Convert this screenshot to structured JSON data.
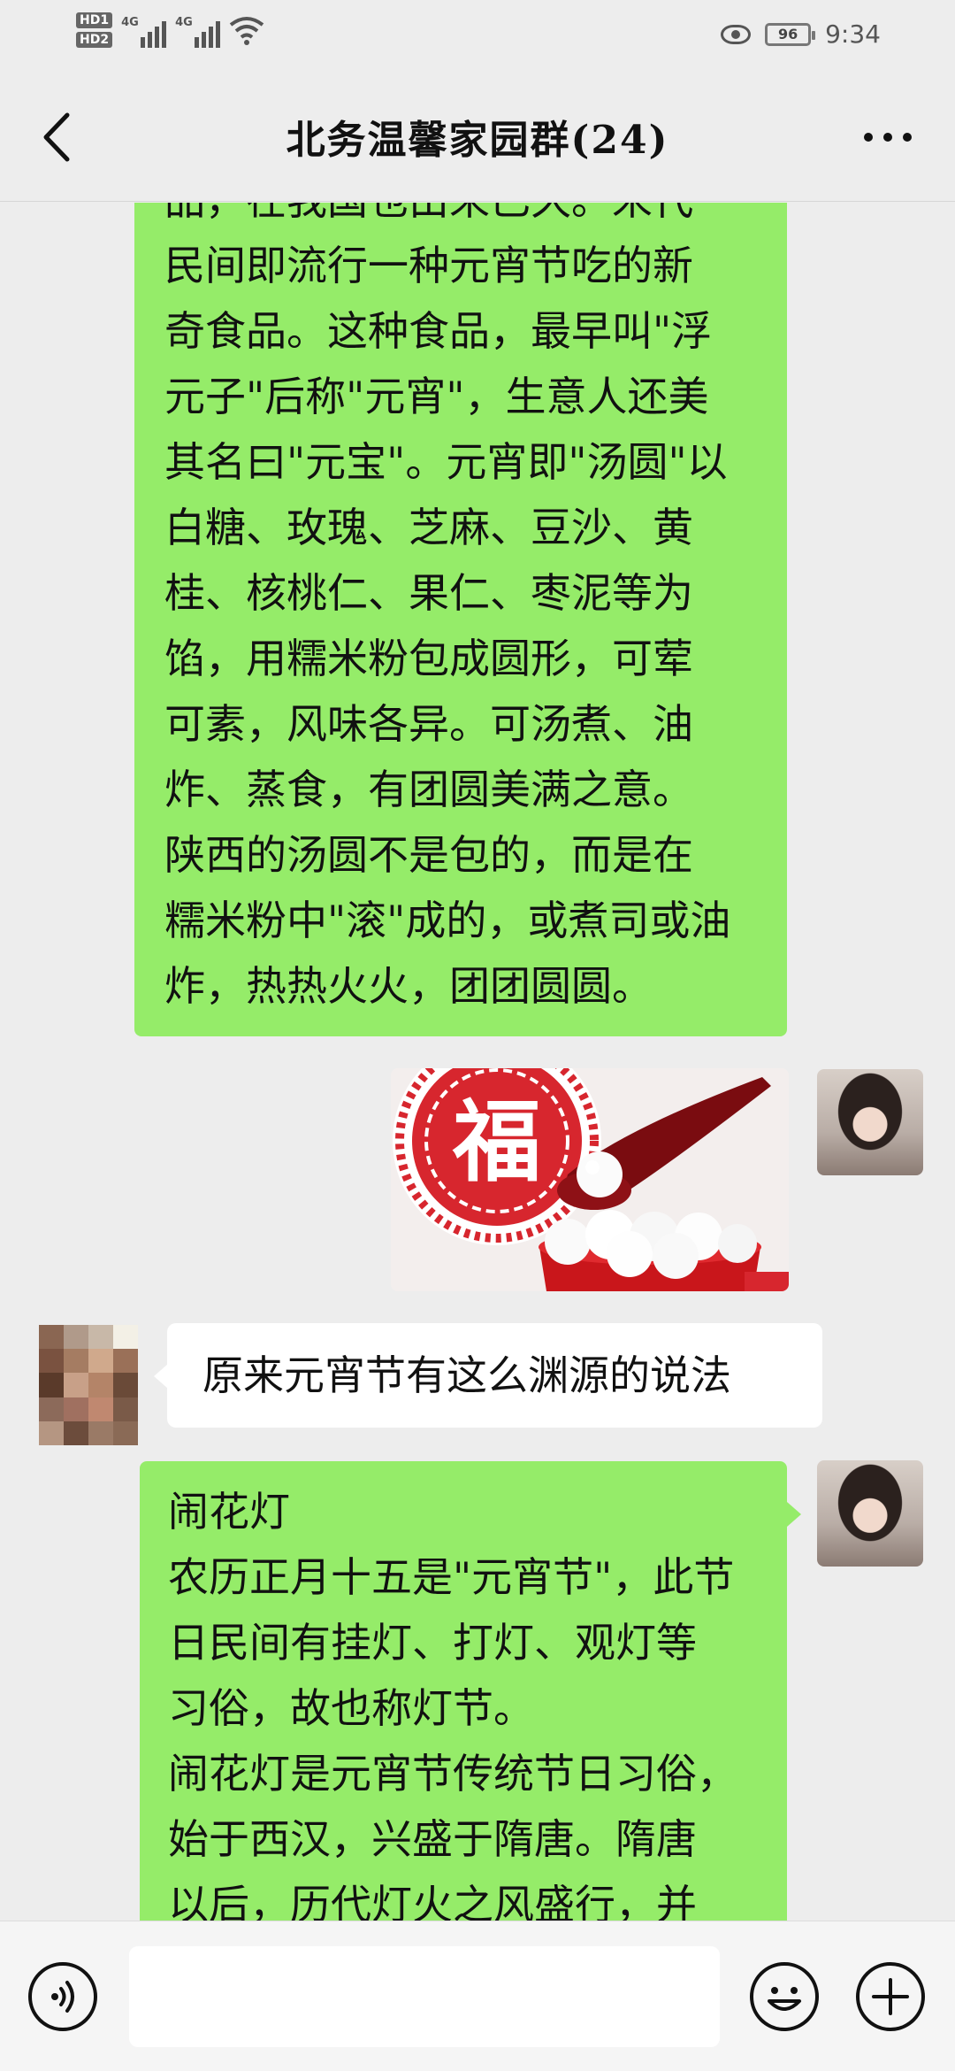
{
  "status_bar": {
    "hd_labels": [
      "HD1",
      "HD2"
    ],
    "network_labels": [
      "4G",
      "4G"
    ],
    "battery": "96",
    "time": "9:34",
    "icons": [
      "hd-icon",
      "signal-icon",
      "wifi-icon",
      "eye-comfort-icon",
      "battery-icon"
    ]
  },
  "header": {
    "title": "北务温馨家园群(24)",
    "back_icon": "chevron-left-icon",
    "more_icon": "more-dots-icon"
  },
  "messages": [
    {
      "side": "right",
      "type": "text",
      "lines": [
        "品，在我国也由来已久。宋代",
        "民间即流行一种元宵节吃的新",
        "奇食品。这种食品，最早叫\"浮",
        "元子\"后称\"元宵\"，生意人还美",
        "其名曰\"元宝\"。元宵即\"汤圆\"以",
        "白糖、玫瑰、芝麻、豆沙、黄",
        "桂、核桃仁、果仁、枣泥等为",
        "馅，用糯米粉包成圆形，可荤",
        "可素，风味各异。可汤煮、油",
        "炸、蒸食，有团圆美满之意。",
        "陕西的汤圆不是包的，而是在",
        "糯米粉中\"滚\"成的，或煮司或油",
        "炸，热热火火，团团圆圆。"
      ]
    },
    {
      "side": "right",
      "type": "image",
      "image_desc": "tangyuan-photo",
      "seal_char": "福"
    },
    {
      "side": "left",
      "type": "text",
      "text": "原来元宵节有这么渊源的说法"
    },
    {
      "side": "right",
      "type": "text",
      "lines": [
        "闹花灯",
        "农历正月十五是\"元宵节\"，此节",
        "日民间有挂灯、打灯、观灯等",
        "习俗，故也称灯节。",
        "闹花灯是元宵节传统节日习俗，",
        "始于西汉，兴盛于隋唐。隋唐",
        "以后，历代灯火之风盛行，并"
      ]
    }
  ],
  "input_bar": {
    "voice_icon": "voice-icon",
    "emoji_icon": "emoji-icon",
    "plus_icon": "plus-icon",
    "value": ""
  },
  "colors": {
    "background": "#ededed",
    "bubble_self": "#95ec69",
    "bubble_other": "#ffffff",
    "seal_red": "#d7262e"
  }
}
